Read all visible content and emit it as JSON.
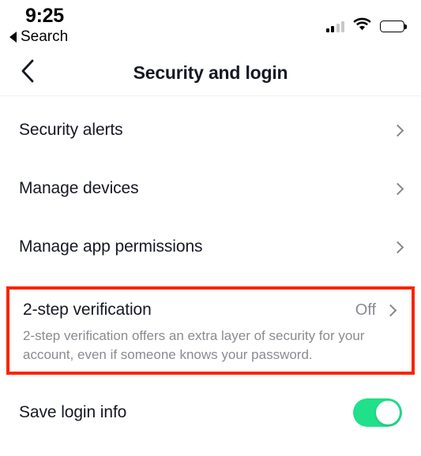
{
  "status_bar": {
    "time": "9:25",
    "back_label": "Search",
    "back_icon": "triangle-left-icon",
    "signal_icon": "cellular-signal-icon",
    "signal_bars_filled": 2,
    "signal_bars_total": 4,
    "wifi_icon": "wifi-icon",
    "battery_icon": "battery-full-icon"
  },
  "header": {
    "back_icon": "chevron-left-icon",
    "title": "Security and login"
  },
  "list": {
    "items": [
      {
        "label": "Security alerts",
        "value": "",
        "chevron": "chevron-right-icon"
      },
      {
        "label": "Manage devices",
        "value": "",
        "chevron": "chevron-right-icon"
      },
      {
        "label": "Manage app permissions",
        "value": "",
        "chevron": "chevron-right-icon"
      }
    ]
  },
  "highlighted_row": {
    "label": "2-step verification",
    "value": "Off",
    "chevron": "chevron-right-icon",
    "description": "2-step verification offers an extra layer of security for your account, even if someone knows your password.",
    "highlight_color": "#fa2400"
  },
  "toggle_row": {
    "label": "Save login info",
    "state": "on",
    "accent_color": "#20e08a"
  }
}
